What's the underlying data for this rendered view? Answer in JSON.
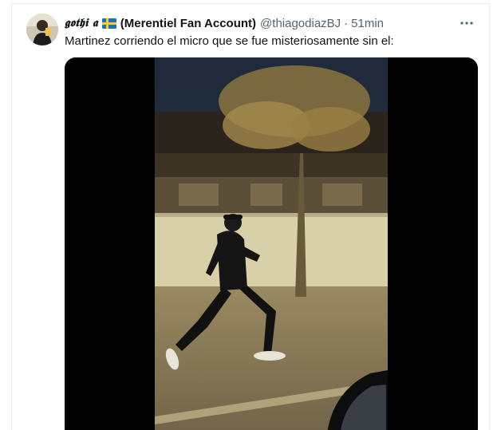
{
  "tweet": {
    "display_name": "𝖌𝖔𝖙𝖍𝖎 𝖆",
    "flag_icon": "sweden-flag",
    "account_name": "(Merentiel Fan Account)",
    "handle": "@thiagodiazBJ",
    "separator": "·",
    "time": "51min",
    "text": "Martinez corriendo el micro que se fue misteriosamente sin el:",
    "more_icon": "more-dots-icon"
  },
  "colors": {
    "text_primary": "#0f1419",
    "text_secondary": "#536471",
    "border": "#e6ecf0",
    "media_bg": "#000000"
  }
}
